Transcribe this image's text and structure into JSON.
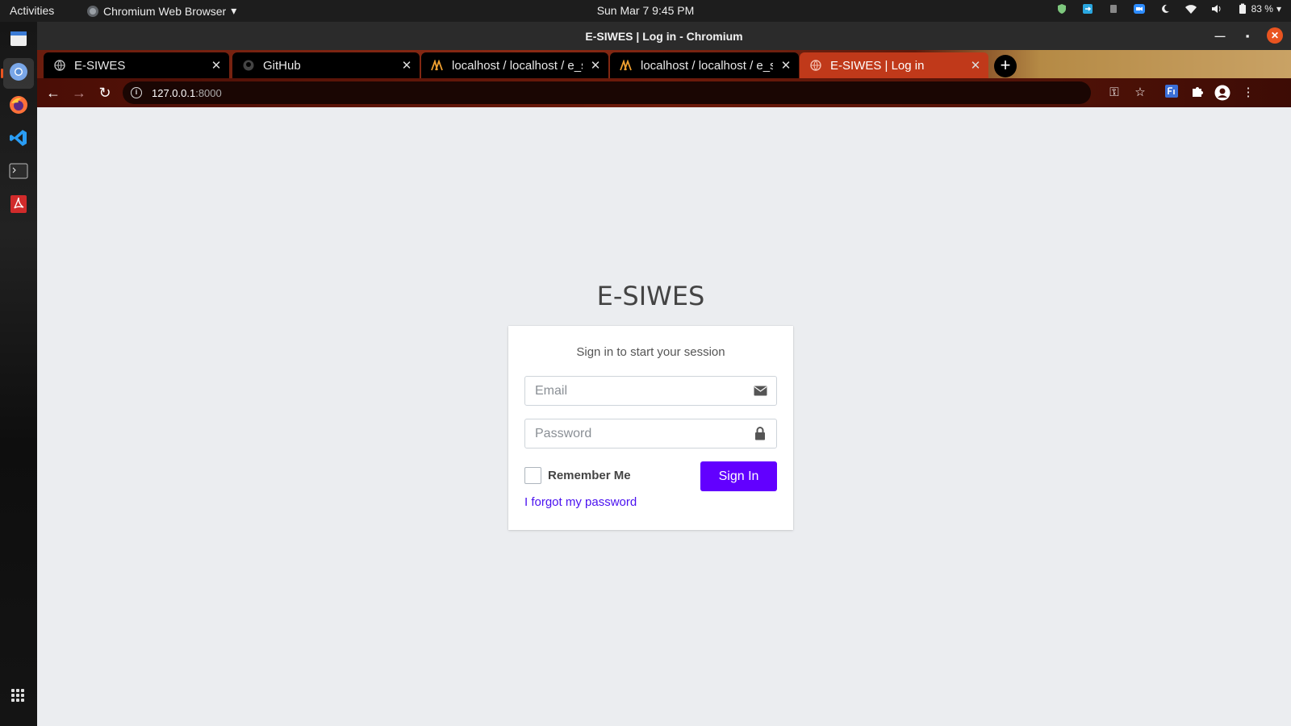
{
  "system": {
    "activities": "Activities",
    "app_menu": "Chromium Web Browser",
    "clock": "Sun Mar 7   9:45 PM",
    "battery": "83 %"
  },
  "window": {
    "title": "E-SIWES | Log in - Chromium"
  },
  "tabs": [
    {
      "label": "E-SIWES",
      "icon": "globe-icon"
    },
    {
      "label": "GitHub",
      "icon": "github-icon"
    },
    {
      "label": "localhost / localhost / e_siwes",
      "icon": "phpmyadmin-icon"
    },
    {
      "label": "localhost / localhost / e_siwes",
      "icon": "phpmyadmin-icon"
    },
    {
      "label": "E-SIWES | Log in",
      "icon": "globe-icon"
    }
  ],
  "address": {
    "host": "127.0.0.1",
    "port": ":8000"
  },
  "login": {
    "brand": "E-SIWES",
    "message": "Sign in to start your session",
    "email_placeholder": "Email",
    "password_placeholder": "Password",
    "remember_label": "Remember Me",
    "signin_label": "Sign In",
    "forgot_label": "I forgot my password"
  },
  "colors": {
    "accent": "#6200ff",
    "link": "#4b12f0",
    "page_bg": "#ebedf0",
    "ubuntu_orange": "#e95420"
  }
}
